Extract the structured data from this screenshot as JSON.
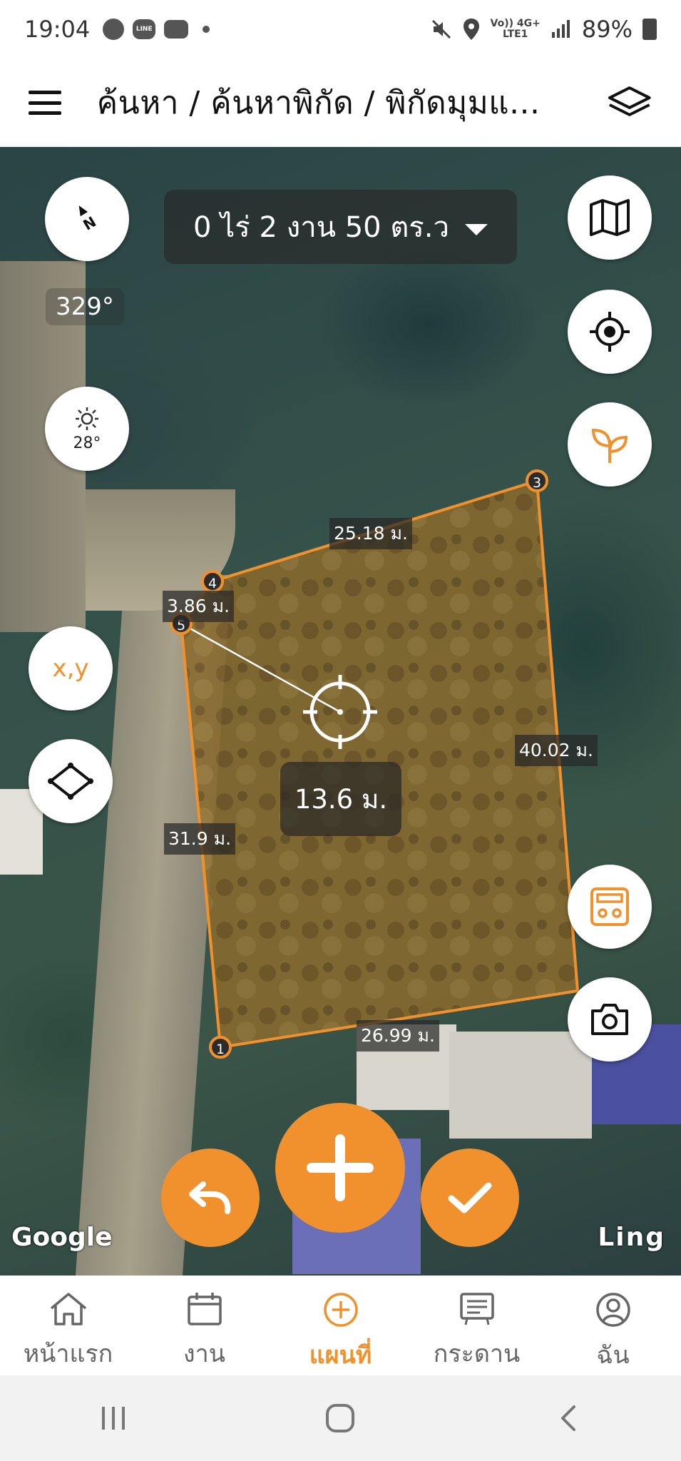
{
  "status_bar": {
    "time": "19:04",
    "network_top": "Vo)) 4G+",
    "network_bottom": "LTE1",
    "battery": "89%",
    "line_icon_text": "LINE"
  },
  "header": {
    "breadcrumb": "ค้นหา / ค้นหาพิกัด / พิกัดมุมแ...",
    "menu_icon": "hamburger-icon",
    "layers_icon": "layers-icon"
  },
  "map": {
    "area_text": "0 ไร่ 2 งาน 50 ตร.ว",
    "compass_heading": "329°",
    "weather_temp": "28°",
    "xy_button_label": "x,y",
    "center_distance": "13.6 ม.",
    "edge_labels": [
      "25.18 ม.",
      "3.86 ม.",
      "40.02 ม.",
      "31.9 ม.",
      "26.99 ม."
    ],
    "vertex_numbers": [
      "1",
      "3",
      "4",
      "5"
    ],
    "attribution_left": "Google",
    "attribution_right": "Ling",
    "accent_color": "#f0912d"
  },
  "bottom_nav": {
    "items": [
      {
        "label": "หน้าแรก",
        "icon": "home-icon"
      },
      {
        "label": "งาน",
        "icon": "calendar-icon"
      },
      {
        "label": "แผนที่",
        "icon": "plus-circle-icon"
      },
      {
        "label": "กระดาน",
        "icon": "board-icon"
      },
      {
        "label": "ฉัน",
        "icon": "profile-icon"
      }
    ],
    "active_index": 2
  }
}
